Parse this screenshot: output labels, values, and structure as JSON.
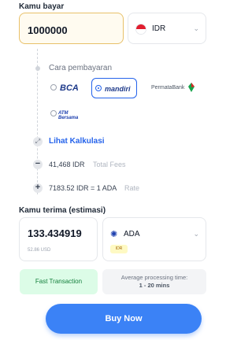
{
  "pay": {
    "label": "Kamu bayar",
    "amount": "1000000",
    "currency": "IDR",
    "chevron": "⌄"
  },
  "payment": {
    "label": "Cara pembayaran",
    "banks": [
      {
        "name": "BCA",
        "selected": false
      },
      {
        "name": "mandiri",
        "selected": true
      },
      {
        "name": "PermataBank",
        "selected": false
      },
      {
        "name": "ATM Bersama",
        "selected": false
      }
    ]
  },
  "calc_link": "Lihat Kalkulasi",
  "fees": {
    "value": "41,468 IDR",
    "label": "Total Fees",
    "op": "−"
  },
  "rate": {
    "value": "7183.52 IDR = 1 ADA",
    "label": "Rate",
    "op": "+"
  },
  "receive": {
    "label": "Kamu terima (estimasi)",
    "amount": "133.434919",
    "usd": "52.86 USD",
    "coin": "ADA",
    "badge": "IDR",
    "chevron": "⌄"
  },
  "fast_label": "Fast Transaction",
  "avg": {
    "title": "Average processing time:",
    "value": "1 - 20 mins"
  },
  "buy_label": "Buy Now",
  "colors": {
    "accent": "#3b82f6",
    "link": "#2563eb",
    "fast_bg": "#dcfce7",
    "fast_text": "#15803d",
    "amount_border": "#e8c069"
  }
}
